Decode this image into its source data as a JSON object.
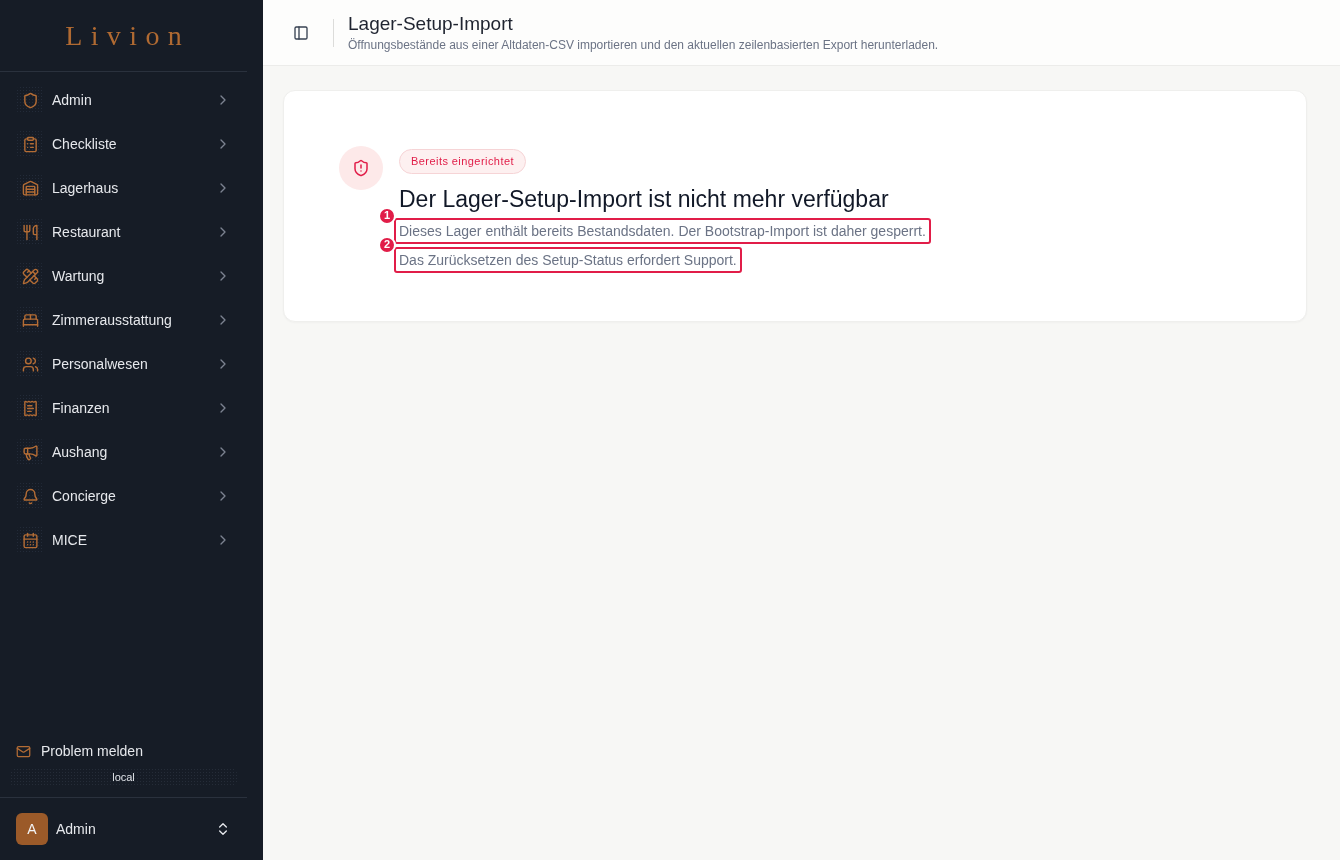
{
  "sidebar": {
    "logo": "Livion",
    "nav_items": [
      {
        "label": "Admin",
        "expanded": false
      },
      {
        "label": "Checkliste",
        "expanded": false
      },
      {
        "label": "Lagerhaus",
        "expanded": false
      },
      {
        "label": "Restaurant",
        "expanded": false
      },
      {
        "label": "Wartung",
        "expanded": false
      },
      {
        "label": "Zimmerausstattung",
        "expanded": false
      },
      {
        "label": "Personalwesen",
        "expanded": false
      },
      {
        "label": "Finanzen",
        "expanded": false
      },
      {
        "label": "Aushang",
        "expanded": false
      },
      {
        "label": "Concierge",
        "expanded": false
      },
      {
        "label": "MICE",
        "expanded": false
      }
    ],
    "report_link": "Problem melden",
    "environment": "local",
    "user": {
      "initial": "A",
      "name": "Admin"
    }
  },
  "header": {
    "title": "Lager-Setup-Import",
    "subtitle": "Öffnungsbestände aus einer Altdaten-CSV importieren und den aktuellen zeilenbasierten Export herunterladen."
  },
  "notice": {
    "badge": "Bereits eingerichtet",
    "title": "Der Lager-Setup-Import ist nicht mehr verfügbar",
    "paragraphs": [
      {
        "text": "Dieses Lager enthält bereits Bestandsdaten. Der Bootstrap-Import ist daher gesperrt.",
        "annotation": "1"
      },
      {
        "text": "Das Zurücksetzen des Setup-Status erfordert Support.",
        "annotation": "2"
      }
    ]
  }
}
